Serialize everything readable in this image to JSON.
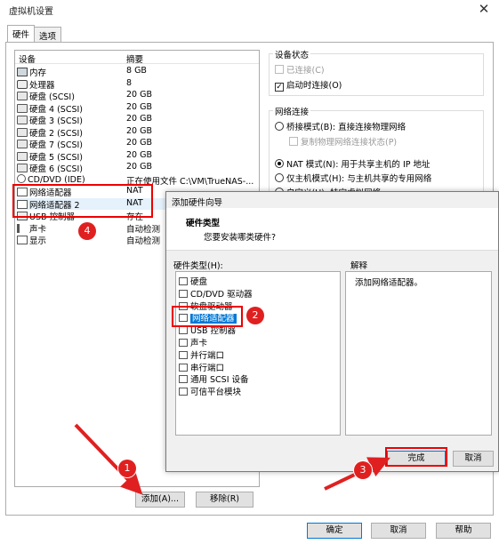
{
  "window": {
    "title": "虚拟机设置",
    "close_glyph": "✕"
  },
  "tabs": [
    {
      "label": "硬件"
    },
    {
      "label": "选项"
    }
  ],
  "device_list": {
    "col_device": "设备",
    "col_summary": "摘要",
    "rows": [
      {
        "name": "内存",
        "summary": "8 GB",
        "icon": "memory-icon"
      },
      {
        "name": "处理器",
        "summary": "8",
        "icon": "processor-icon"
      },
      {
        "name": "硬盘 (SCSI)",
        "summary": "20 GB",
        "icon": "hard-disk-icon"
      },
      {
        "name": "硬盘 4 (SCSI)",
        "summary": "20 GB",
        "icon": "hard-disk-icon"
      },
      {
        "name": "硬盘 3 (SCSI)",
        "summary": "20 GB",
        "icon": "hard-disk-icon"
      },
      {
        "name": "硬盘 2 (SCSI)",
        "summary": "20 GB",
        "icon": "hard-disk-icon"
      },
      {
        "name": "硬盘 7 (SCSI)",
        "summary": "20 GB",
        "icon": "hard-disk-icon"
      },
      {
        "name": "硬盘 5 (SCSI)",
        "summary": "20 GB",
        "icon": "hard-disk-icon"
      },
      {
        "name": "硬盘 6 (SCSI)",
        "summary": "20 GB",
        "icon": "hard-disk-icon"
      },
      {
        "name": "CD/DVD (IDE)",
        "summary": "正在使用文件 C:\\VM\\TrueNAS-...",
        "icon": "cd-dvd-icon"
      },
      {
        "name": "网络适配器",
        "summary": "NAT",
        "icon": "network-adapter-icon"
      },
      {
        "name": "网络适配器 2",
        "summary": "NAT",
        "icon": "network-adapter-icon"
      },
      {
        "name": "USB 控制器",
        "summary": "存在",
        "icon": "usb-icon"
      },
      {
        "name": "声卡",
        "summary": "自动检测",
        "icon": "sound-card-icon"
      },
      {
        "name": "显示",
        "summary": "自动检测",
        "icon": "display-icon"
      }
    ]
  },
  "buttons": {
    "add": "添加(A)...",
    "remove": "移除(R)",
    "ok": "确定",
    "cancel": "取消",
    "help": "帮助"
  },
  "device_status": {
    "title": "设备状态",
    "connected": "已连接(C)",
    "connect_on_power": "启动时连接(O)"
  },
  "network_connection": {
    "title": "网络连接",
    "bridged": "桥接模式(B): 直接连接物理网络",
    "replicate": "复制物理网络连接状态(P)",
    "nat": "NAT 模式(N): 用于共享主机的 IP 地址",
    "host_only": "仅主机模式(H): 与主机共享的专用网络",
    "custom": "自定义(U): 特定虚拟网络"
  },
  "wizard": {
    "title": "添加硬件向导",
    "heading": "硬件类型",
    "subheading": "您要安装哪类硬件?",
    "list_label": "硬件类型(H):",
    "explanation_label": "解释",
    "explanation_text": "添加网络适配器。",
    "items": [
      {
        "label": "硬盘",
        "icon": "hard-disk-icon"
      },
      {
        "label": "CD/DVD 驱动器",
        "icon": "cd-dvd-icon"
      },
      {
        "label": "软盘驱动器",
        "icon": "floppy-icon"
      },
      {
        "label": "网络适配器",
        "icon": "network-adapter-icon"
      },
      {
        "label": "USB 控制器",
        "icon": "usb-icon"
      },
      {
        "label": "声卡",
        "icon": "sound-card-icon"
      },
      {
        "label": "并行端口",
        "icon": "parallel-port-icon"
      },
      {
        "label": "串行端口",
        "icon": "serial-port-icon"
      },
      {
        "label": "通用 SCSI 设备",
        "icon": "scsi-icon"
      },
      {
        "label": "可信平台模块",
        "icon": "tpm-icon"
      }
    ],
    "finish": "完成",
    "cancel": "取消"
  },
  "annotations": {
    "step1": "1",
    "step2": "2",
    "step3": "3",
    "step4": "4"
  },
  "colors": {
    "annotation_red": "#e02020",
    "selection_blue": "#0078d7"
  }
}
